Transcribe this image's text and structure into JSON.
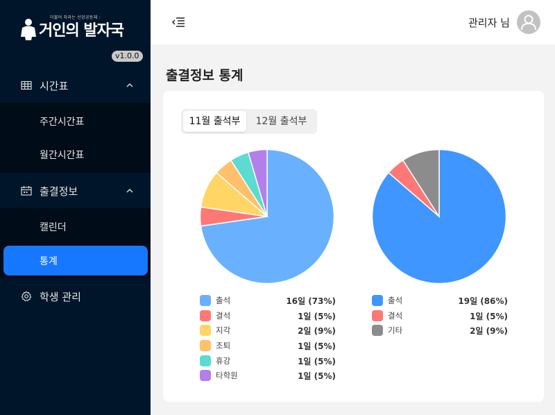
{
  "sidebar": {
    "logo_tagline": "더불어 자라는 신앙공동체 :",
    "logo_text": "거인의 발자국",
    "version": "v1.0.0",
    "groups": [
      {
        "label": "시간표",
        "icon": "calendar-grid-icon",
        "expanded": true,
        "items": [
          {
            "label": "주간시간표"
          },
          {
            "label": "월간시간표"
          }
        ]
      },
      {
        "label": "출결정보",
        "icon": "calendar-check-icon",
        "expanded": true,
        "items": [
          {
            "label": "캘린더"
          },
          {
            "label": "통계",
            "active": true
          }
        ]
      },
      {
        "label": "학생 관리",
        "icon": "gear-icon"
      }
    ]
  },
  "header": {
    "toggle_icon": "menu-fold-icon",
    "user_name": "관리자 님",
    "avatar_icon": "user-icon"
  },
  "page": {
    "title": "출결정보 통계",
    "tabs": [
      {
        "label": "11월 출석부",
        "active": true
      },
      {
        "label": "12월 출석부"
      }
    ]
  },
  "chart_data": [
    {
      "type": "pie",
      "title": "",
      "labels": [
        "출석",
        "결석",
        "지각",
        "조퇴",
        "휴강",
        "타학원"
      ],
      "values": [
        16,
        1,
        2,
        1,
        1,
        1
      ],
      "value_texts": [
        "16일 (73%)",
        "1일 (5%)",
        "2일 (9%)",
        "1일 (5%)",
        "1일 (5%)",
        "1일 (5%)"
      ],
      "colors": [
        "#69b1ff",
        "#ff7875",
        "#ffd666",
        "#ffc069",
        "#5cdbd3",
        "#b37feb"
      ]
    },
    {
      "type": "pie",
      "title": "",
      "labels": [
        "출석",
        "결석",
        "기타"
      ],
      "values": [
        19,
        1,
        2
      ],
      "value_texts": [
        "19일 (86%)",
        "1일 (5%)",
        "2일 (9%)"
      ],
      "colors": [
        "#4096ff",
        "#ff7875",
        "#8c8c8c"
      ]
    }
  ]
}
